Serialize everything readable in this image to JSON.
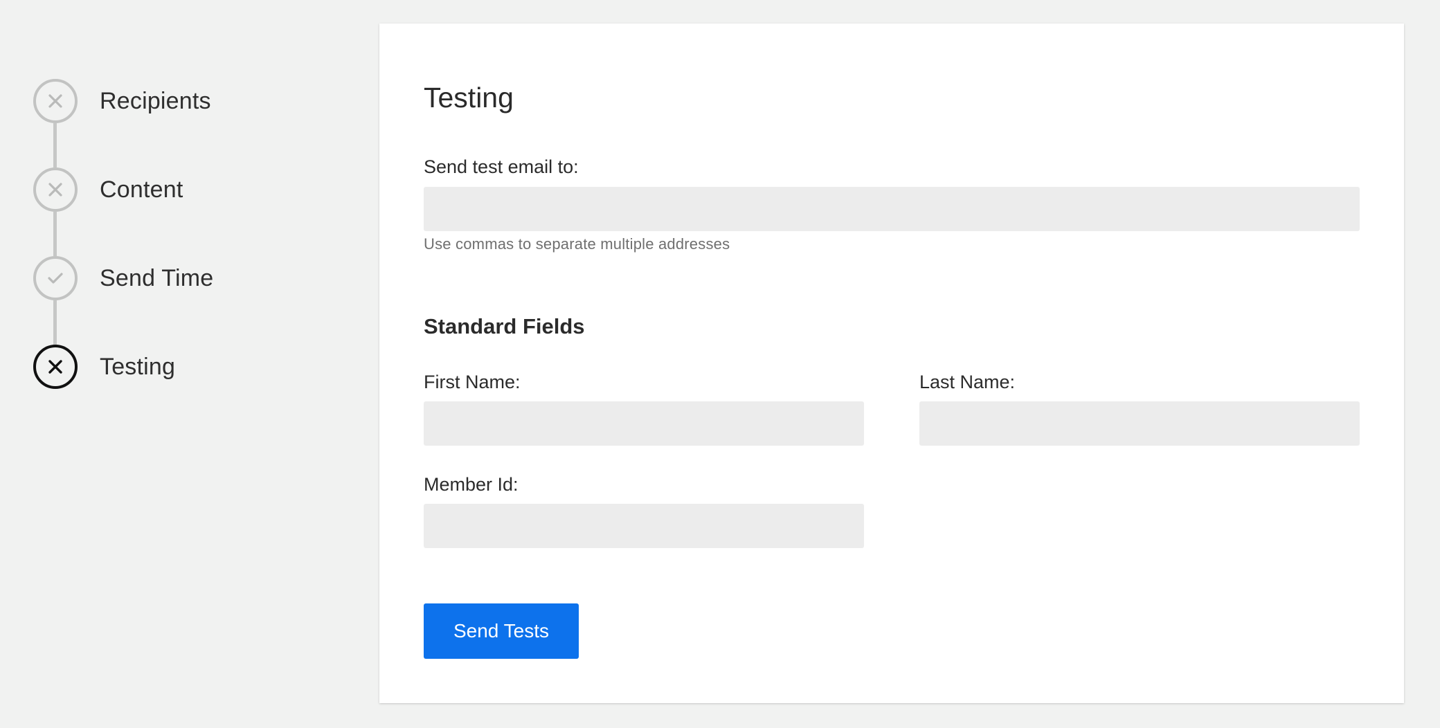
{
  "stepper": {
    "steps": [
      {
        "label": "Recipients",
        "status_icon": "x-icon",
        "state": "incomplete"
      },
      {
        "label": "Content",
        "status_icon": "x-icon",
        "state": "incomplete"
      },
      {
        "label": "Send Time",
        "status_icon": "check-icon",
        "state": "complete"
      },
      {
        "label": "Testing",
        "status_icon": "x-icon",
        "state": "active"
      }
    ],
    "colors": {
      "inactive": "#c2c3c2",
      "active": "#111111",
      "line": "#c6c7c6"
    }
  },
  "card": {
    "title": "Testing",
    "test_email": {
      "label": "Send test email to:",
      "value": "",
      "placeholder": "",
      "hint": "Use commas to separate multiple addresses"
    },
    "standard_fields": {
      "title": "Standard Fields",
      "first_name": {
        "label": "First Name:",
        "value": ""
      },
      "last_name": {
        "label": "Last Name:",
        "value": ""
      },
      "member_id": {
        "label": "Member Id:",
        "value": ""
      }
    },
    "send_button": {
      "label": "Send Tests",
      "color": "#0d72ec"
    }
  }
}
